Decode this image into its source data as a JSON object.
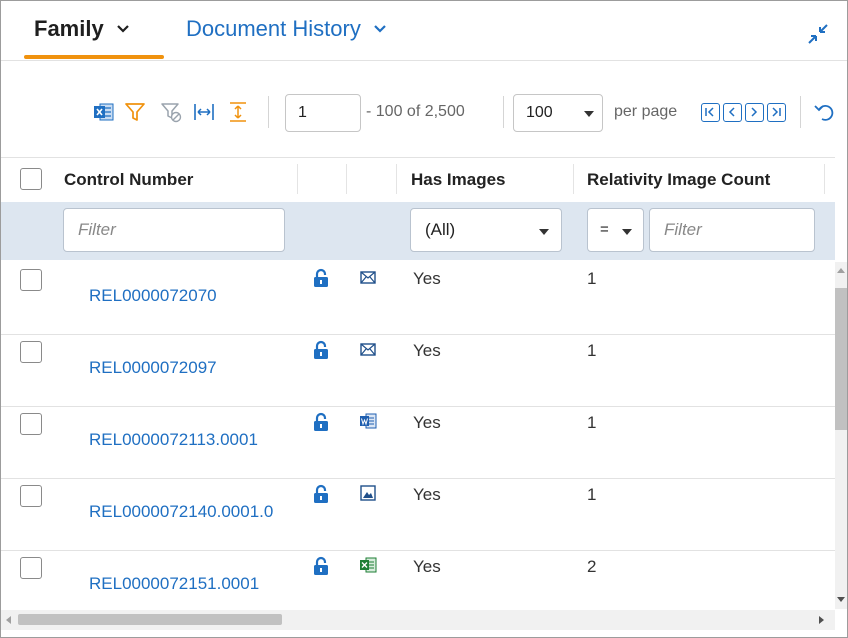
{
  "tabs": {
    "family_label": "Family",
    "history_label": "Document History"
  },
  "toolbar": {
    "icons": [
      "excel-export-icon",
      "filter-icon",
      "clear-filter-icon",
      "fit-columns-icon",
      "fit-rows-icon"
    ],
    "page_value": "1",
    "range_text": "- 100 of 2,500",
    "page_size": "100",
    "per_page_label": "per page",
    "nav_icons": [
      "first-page-icon",
      "prev-page-icon",
      "next-page-icon",
      "last-page-icon"
    ]
  },
  "columns": {
    "control_number": "Control Number",
    "has_images": "Has Images",
    "image_count": "Relativity Image Count"
  },
  "filters": {
    "control_number_placeholder": "Filter",
    "has_images_value": "(All)",
    "image_count_operator": "=",
    "image_count_placeholder": "Filter"
  },
  "rows": [
    {
      "control_number": "REL0000072070",
      "file_type": "email",
      "has_images": "Yes",
      "image_count": "1"
    },
    {
      "control_number": "REL0000072097",
      "file_type": "email",
      "has_images": "Yes",
      "image_count": "1"
    },
    {
      "control_number": "REL0000072113.0001",
      "file_type": "word",
      "has_images": "Yes",
      "image_count": "1"
    },
    {
      "control_number": "REL0000072140.0001.0",
      "file_type": "image",
      "has_images": "Yes",
      "image_count": "1"
    },
    {
      "control_number": "REL0000072151.0001",
      "file_type": "excel",
      "has_images": "Yes",
      "image_count": "2"
    }
  ],
  "colors": {
    "accent": "#f0920e",
    "link": "#1f6fc2",
    "filter_row_bg": "#dde6f0",
    "excel_green": "#1e7e34"
  }
}
